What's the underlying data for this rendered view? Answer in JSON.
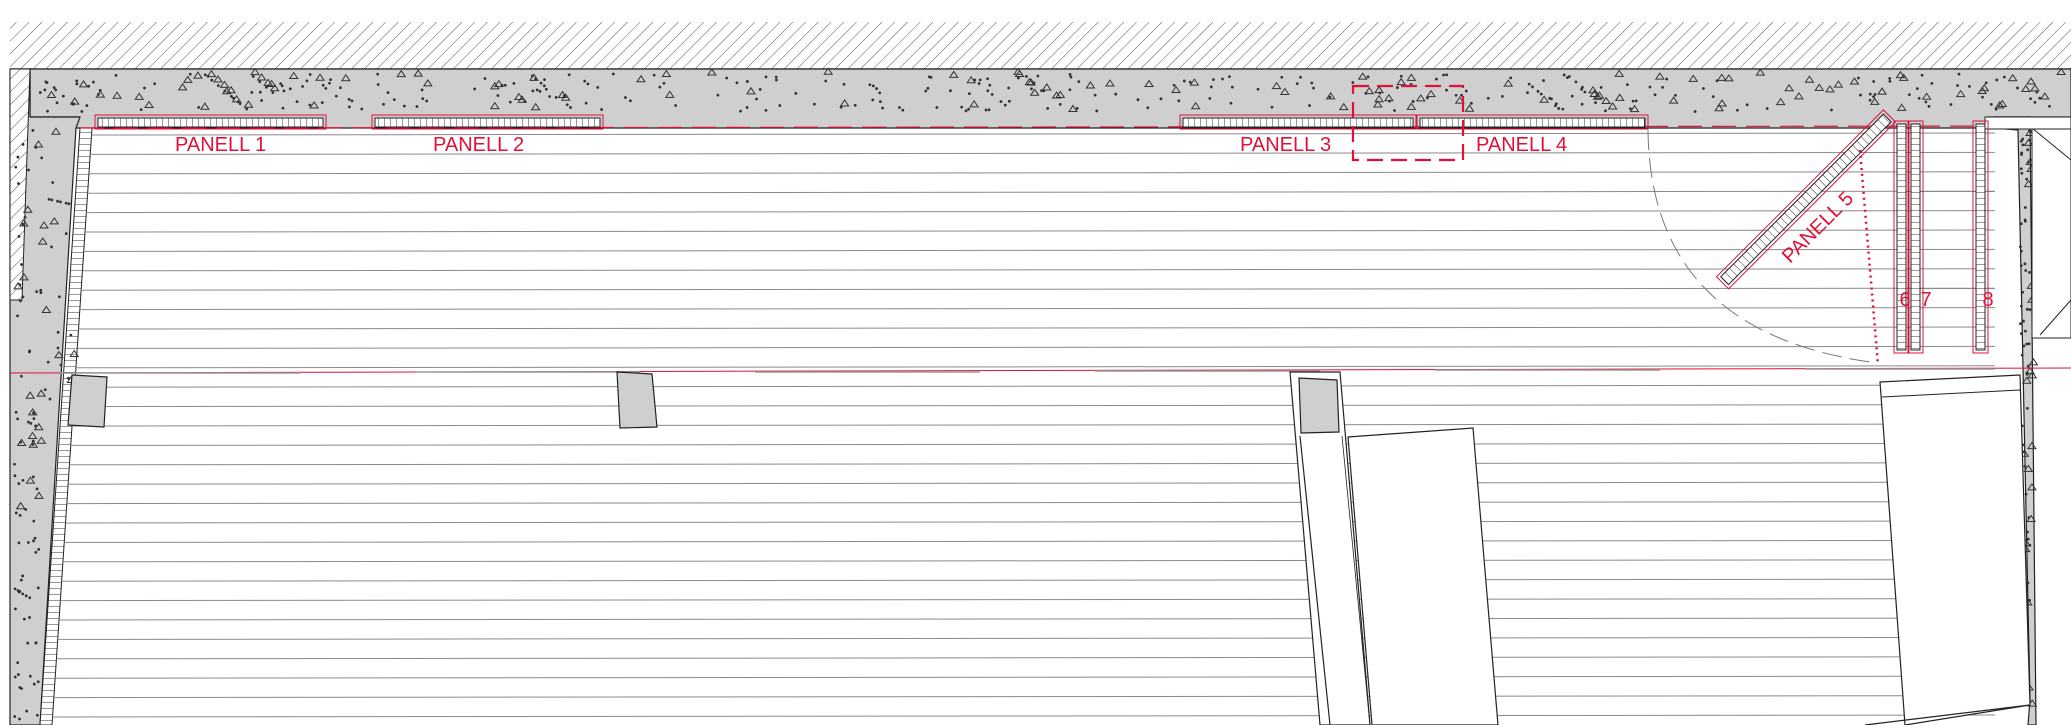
{
  "drawing": {
    "panel_labels": [
      "PANELL 1",
      "PANELL 2",
      "PANELL 3",
      "PANELL 4",
      "PANELL 5",
      "6",
      "7",
      "8"
    ],
    "colors": {
      "annotation": "#e0103a",
      "concrete": "#cfcfcf",
      "linework": "#222222",
      "floor_lines": "#8a8a8a",
      "background": "#ffffff"
    }
  }
}
